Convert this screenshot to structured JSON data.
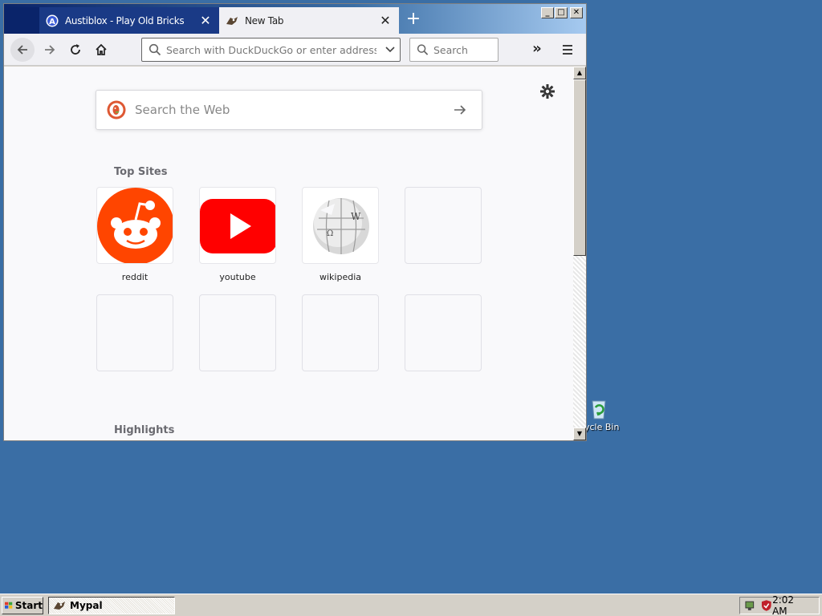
{
  "desktop": {
    "recycle_bin_label": "ycle Bin"
  },
  "browser": {
    "tabs": [
      {
        "title": "Austiblox - Play Old Bricks",
        "active": false
      },
      {
        "title": "New Tab",
        "active": true
      }
    ],
    "url_placeholder": "Search with DuckDuckGo or enter address",
    "search_placeholder": "Search",
    "overflow_label": "»",
    "content": {
      "web_search_placeholder": "Search the Web",
      "top_sites_title": "Top Sites",
      "top_sites": [
        {
          "label": "reddit",
          "icon": "reddit-icon"
        },
        {
          "label": "youtube",
          "icon": "youtube-icon"
        },
        {
          "label": "wikipedia",
          "icon": "wikipedia-icon"
        }
      ],
      "highlights_title": "Highlights"
    },
    "colors": {
      "reddit": "#ff4500",
      "youtube": "#ff0000",
      "accent": "#0a246a"
    }
  },
  "taskbar": {
    "start_label": "Start",
    "task_label": "Mypal",
    "clock": "2:02 AM"
  }
}
